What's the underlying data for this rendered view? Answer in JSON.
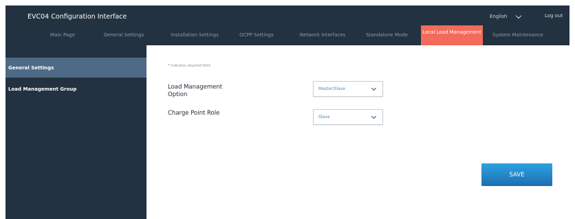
{
  "app": {
    "title": "EVC04 Configuration Interface"
  },
  "header": {
    "language": "English",
    "logout": "Log out"
  },
  "nav": [
    {
      "label": "Main Page"
    },
    {
      "label": "General Settings"
    },
    {
      "label": "Installation Settings"
    },
    {
      "label": "OCPP Settings"
    },
    {
      "label": "Network Interfaces"
    },
    {
      "label": "Standalone Mode"
    },
    {
      "label": "Local Load Management",
      "active": true
    },
    {
      "label": "System Maintenance"
    }
  ],
  "sidebar": {
    "items": [
      {
        "label": "General Settings",
        "active": true
      },
      {
        "label": "Load Management Group"
      }
    ]
  },
  "form": {
    "required_star": "*",
    "required_note": "Indicates required field",
    "fields": [
      {
        "label": "Load Management Option",
        "value": "Master/Slave"
      },
      {
        "label": "Charge Point Role",
        "value": "Slave"
      }
    ],
    "save_label": "SAVE"
  },
  "colors": {
    "header_bg": "#233240",
    "active_tab": "#f26b5b",
    "sidebar_active": "#4e6a86",
    "save_button": "#1f88cc",
    "select_value": "#3b8fc8"
  }
}
